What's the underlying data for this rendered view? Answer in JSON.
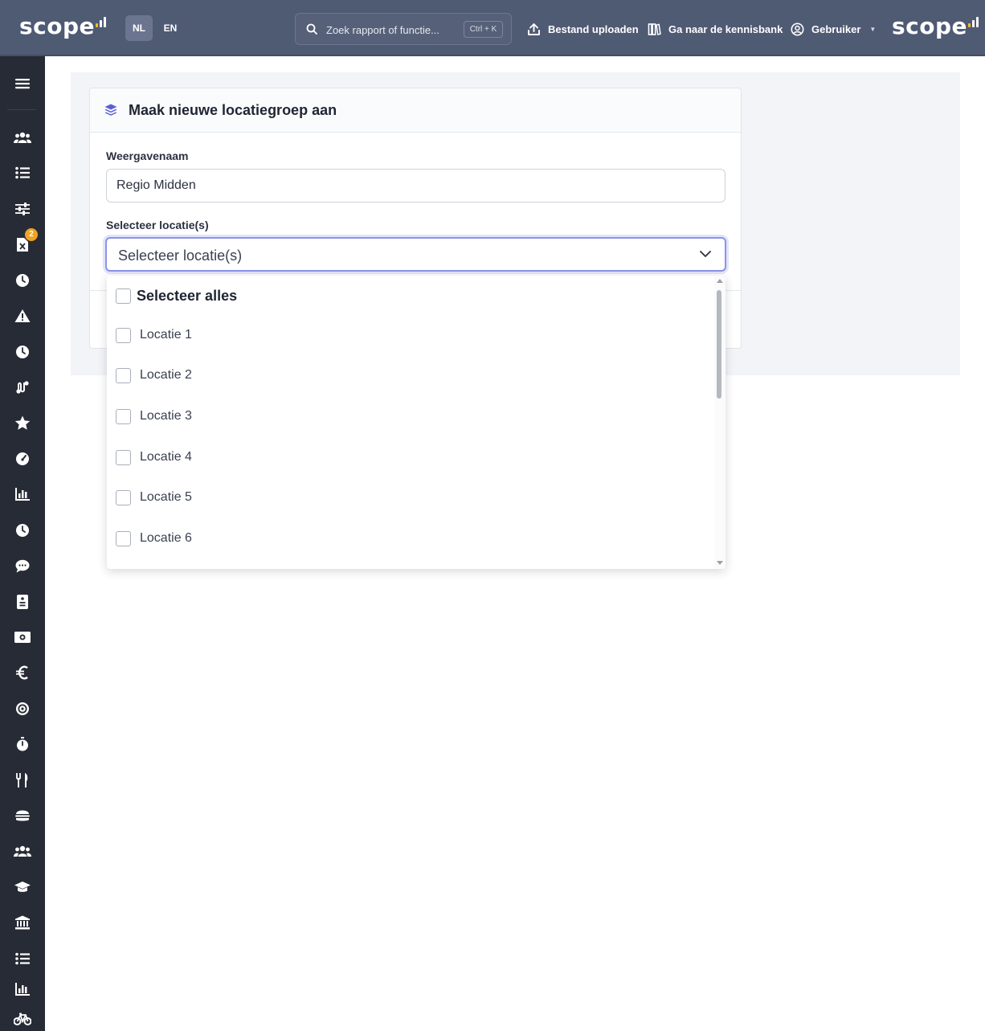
{
  "topbar": {
    "logo_text": "scope",
    "lang_nl": "NL",
    "lang_en": "EN",
    "search_placeholder": "Zoek rapport of functie...",
    "search_shortcut": "Ctrl + K",
    "upload_label": "Bestand uploaden",
    "kb_label": "Ga naar de kennisbank",
    "user_label": "Gebruiker"
  },
  "sidebar": {
    "notification_badge": "2",
    "items": [
      "menu-icon",
      "users-icon",
      "list-icon",
      "sliders-icon",
      "excel-file-icon",
      "clock-icon",
      "warning-icon",
      "clock-icon",
      "route-icon",
      "star-icon",
      "gauge-icon",
      "bar-chart-icon",
      "clock-icon",
      "chat-icon",
      "document-icon",
      "money-icon",
      "euro-icon",
      "target-icon",
      "stopwatch-icon",
      "utensils-icon",
      "burger-icon",
      "team-icon",
      "graduation-cap-icon",
      "bank-icon",
      "list-icon",
      "bar-chart-icon",
      "bicycle-icon"
    ]
  },
  "form": {
    "title": "Maak nieuwe locatiegroep aan",
    "name_label": "Weergavenaam",
    "name_value": "Regio Midden",
    "location_label": "Selecteer locatie(s)",
    "location_placeholder": "Selecteer locatie(s)"
  },
  "dropdown": {
    "select_all": "Selecteer alles",
    "options": [
      "Locatie 1",
      "Locatie 2",
      "Locatie 3",
      "Locatie 4",
      "Locatie 5",
      "Locatie 6"
    ]
  },
  "colors": {
    "topbar": "#4f5a73",
    "sidebar": "#262b36",
    "accent": "#8b93e8",
    "badge": "#f0a223",
    "logo_bar": "#f5b82e"
  }
}
